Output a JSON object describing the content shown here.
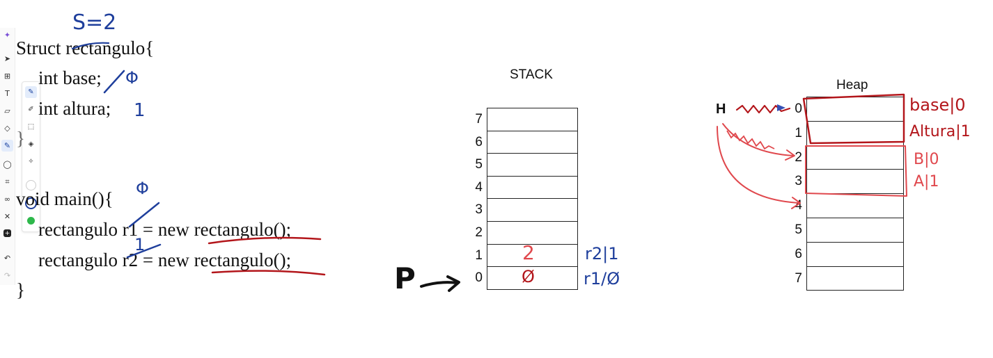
{
  "code": {
    "line1": "Struct rectangulo{",
    "line2": "int base;",
    "line3": "int altura;",
    "line4": "}",
    "line5": "void main(){",
    "line6": "rectangulo r1 = new rectangulo();",
    "line7": "rectangulo r2 = new rectangulo();",
    "line8": "}"
  },
  "stack": {
    "title": "STACK",
    "indices": [
      "7",
      "6",
      "5",
      "4",
      "3",
      "2",
      "1",
      "0"
    ],
    "pointer_label": "P"
  },
  "heap": {
    "title": "Heap",
    "indices": [
      "0",
      "1",
      "2",
      "3",
      "4",
      "5",
      "6",
      "7"
    ],
    "pointer_label": "H"
  },
  "annotations": {
    "size_note": "S=2",
    "base_offset": "Φ",
    "altura_offset": "1",
    "main_offset": "Φ",
    "r2_offset": "1",
    "stack_cell1": "2",
    "stack_cell0": "Ø",
    "stack_side1": "r2|1",
    "stack_side0": "r1/Ø",
    "heap_side0": "base|0",
    "heap_side1": "Altura|1",
    "heap_side2": "B|0",
    "heap_side3": "A|1"
  },
  "toolbar": {
    "tools": [
      "sparkle-icon",
      "pointer-icon",
      "frame-icon",
      "text-icon",
      "sticky-note-icon",
      "shapes-icon",
      "pen-icon",
      "comment-icon",
      "crop-icon",
      "link-icon",
      "connector-icon",
      "add-icon",
      "undo-icon",
      "redo-icon"
    ],
    "pen_options": [
      "pen-icon",
      "highlighter-icon",
      "lasso-icon",
      "eraser-icon",
      "magic-icon"
    ],
    "colors": [
      "#ffffff",
      "#1f3f9c",
      "#2eb84b"
    ]
  }
}
